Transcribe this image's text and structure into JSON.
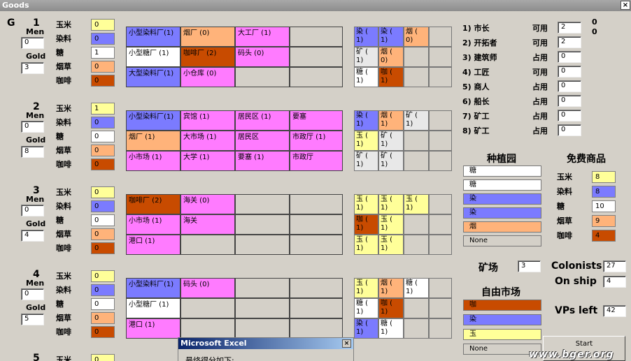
{
  "window": {
    "title": "Goods",
    "close": "×"
  },
  "g_label": "G",
  "labels": {
    "men": "Men",
    "gold": "Gold",
    "corn": "玉米",
    "indigo": "染料",
    "sugar": "糖",
    "tobacco": "烟草",
    "coffee": "咖啡"
  },
  "players": [
    {
      "num": "1",
      "men": "0",
      "gold": "3",
      "goods": [
        "0",
        "0",
        "1",
        "0",
        "0"
      ],
      "buildings": [
        [
          "小型染料厂(1)",
          "c-indigo"
        ],
        [
          "烟厂 (0)",
          "c-tobacco"
        ],
        [
          "大工厂 (1)",
          "c-pink"
        ],
        [
          "",
          ""
        ],
        [
          "小型糖厂 (1)",
          "c-sugar"
        ],
        [
          "咖啡厂 (2)",
          "c-coffee"
        ],
        [
          "码头 (0)",
          "c-pink"
        ],
        [
          "",
          ""
        ],
        [
          "大型染料厂(1)",
          "c-indigo"
        ],
        [
          "小仓库 (0)",
          "c-pink"
        ],
        [
          "",
          ""
        ],
        [
          "",
          ""
        ]
      ],
      "fields": [
        [
          "染 ( 1)",
          "c-indigo"
        ],
        [
          "染 ( 1)",
          "c-indigo"
        ],
        [
          "烟 ( 0)",
          "c-tobacco"
        ],
        [
          "",
          ""
        ],
        [
          "矿 ( 1)",
          "c-light"
        ],
        [
          "烟 ( 0)",
          "c-tobacco"
        ],
        [
          "",
          ""
        ],
        [
          "",
          ""
        ],
        [
          "糖 ( 1)",
          "c-sugar"
        ],
        [
          "咖 ( 1)",
          "c-coffee"
        ],
        [
          "",
          ""
        ],
        [
          "",
          ""
        ]
      ]
    },
    {
      "num": "2",
      "men": "0",
      "gold": "8",
      "goods": [
        "1",
        "0",
        "0",
        "0",
        "0"
      ],
      "buildings": [
        [
          "小型染料厂(1)",
          "c-indigo"
        ],
        [
          "宾馆 (1)",
          "c-pink"
        ],
        [
          "居民区 (1)",
          "c-pink"
        ],
        [
          "要塞",
          "c-pink"
        ],
        [
          "烟厂 (1)",
          "c-tobacco"
        ],
        [
          "大市场 (1)",
          "c-pink"
        ],
        [
          "居民区",
          "c-pink"
        ],
        [
          "市政厅 (1)",
          "c-pink"
        ],
        [
          "小市场 (1)",
          "c-pink"
        ],
        [
          "大学 (1)",
          "c-pink"
        ],
        [
          "要塞 (1)",
          "c-pink"
        ],
        [
          "市政厅",
          "c-pink"
        ]
      ],
      "fields": [
        [
          "染 ( 1)",
          "c-indigo"
        ],
        [
          "烟 ( 1)",
          "c-tobacco"
        ],
        [
          "矿 ( 1)",
          "c-light"
        ],
        [
          "",
          ""
        ],
        [
          "玉 ( 1)",
          "c-corn"
        ],
        [
          "矿 ( 1)",
          "c-light"
        ],
        [
          "",
          ""
        ],
        [
          "",
          ""
        ],
        [
          "矿 ( 1)",
          "c-light"
        ],
        [
          "矿 ( 1)",
          "c-light"
        ],
        [
          "",
          ""
        ],
        [
          "",
          ""
        ]
      ]
    },
    {
      "num": "3",
      "men": "0",
      "gold": "4",
      "goods": [
        "0",
        "0",
        "0",
        "0",
        "0"
      ],
      "buildings": [
        [
          "咖啡厂 (2)",
          "c-coffee"
        ],
        [
          "海关 (0)",
          "c-pink"
        ],
        [
          "",
          ""
        ],
        [
          "",
          ""
        ],
        [
          "小市场 (1)",
          "c-pink"
        ],
        [
          "海关",
          "c-pink"
        ],
        [
          "",
          ""
        ],
        [
          "",
          ""
        ],
        [
          "港口 (1)",
          "c-pink"
        ],
        [
          "",
          ""
        ],
        [
          "",
          ""
        ],
        [
          "",
          ""
        ]
      ],
      "fields": [
        [
          "玉 ( 1)",
          "c-corn"
        ],
        [
          "玉 ( 1)",
          "c-corn"
        ],
        [
          "玉 ( 1)",
          "c-corn"
        ],
        [
          "",
          ""
        ],
        [
          "咖 ( 1)",
          "c-coffee"
        ],
        [
          "玉 ( 1)",
          "c-corn"
        ],
        [
          "",
          ""
        ],
        [
          "",
          ""
        ],
        [
          "玉 ( 1)",
          "c-corn"
        ],
        [
          "玉 ( 1)",
          "c-corn"
        ],
        [
          "",
          ""
        ],
        [
          "",
          ""
        ]
      ]
    },
    {
      "num": "4",
      "men": "0",
      "gold": "5",
      "goods": [
        "0",
        "0",
        "0",
        "0",
        "0"
      ],
      "buildings": [
        [
          "小型染料厂(1)",
          "c-indigo"
        ],
        [
          "码头 (0)",
          "c-pink"
        ],
        [
          "",
          ""
        ],
        [
          "",
          ""
        ],
        [
          "小型糖厂 (1)",
          "c-sugar"
        ],
        [
          "",
          ""
        ],
        [
          "",
          ""
        ],
        [
          "",
          ""
        ],
        [
          "港口 (1)",
          "c-pink"
        ],
        [
          "",
          ""
        ],
        [
          "",
          ""
        ],
        [
          "",
          ""
        ]
      ],
      "fields": [
        [
          "玉 ( 1)",
          "c-corn"
        ],
        [
          "烟 ( 1)",
          "c-tobacco"
        ],
        [
          "糖 ( 1)",
          "c-sugar"
        ],
        [
          "",
          ""
        ],
        [
          "糖 ( 1)",
          "c-sugar"
        ],
        [
          "咖 ( 1)",
          "c-coffee"
        ],
        [
          "",
          ""
        ],
        [
          "",
          ""
        ],
        [
          "染 ( 1)",
          "c-indigo"
        ],
        [
          "糖 ( 1)",
          "c-sugar"
        ],
        [
          "",
          ""
        ],
        [
          "",
          ""
        ]
      ]
    }
  ],
  "p5": {
    "num": "5",
    "corn": "玉米",
    "value": "0"
  },
  "roles": [
    {
      "name": "1) 市长",
      "status": "可用",
      "value": "2"
    },
    {
      "name": "2) 开拓者",
      "status": "可用",
      "value": "2"
    },
    {
      "name": "3) 建筑师",
      "status": "占用",
      "value": "0"
    },
    {
      "name": "4) 工匠",
      "status": "可用",
      "value": "0"
    },
    {
      "name": "5) 商人",
      "status": "占用",
      "value": "0"
    },
    {
      "name": "6) 船长",
      "status": "占用",
      "value": "0"
    },
    {
      "name": "7) 矿工",
      "status": "占用",
      "value": "0"
    },
    {
      "name": "8) 矿工",
      "status": "占用",
      "value": "0"
    }
  ],
  "top_right": [
    "0",
    "0"
  ],
  "plantation": {
    "title": "种植园",
    "items": [
      [
        "糖",
        "c-sugar"
      ],
      [
        "糖",
        "c-sugar"
      ],
      [
        "染",
        "c-indigo"
      ],
      [
        "染",
        "c-indigo"
      ],
      [
        "烟",
        "c-tobacco"
      ],
      [
        "None",
        "c-gray"
      ]
    ]
  },
  "free_goods": {
    "title": "免费商品",
    "items": [
      [
        "玉米",
        "8",
        "c-corn"
      ],
      [
        "染料",
        "8",
        "c-indigo"
      ],
      [
        "糖",
        "10",
        "c-sugar"
      ],
      [
        "烟草",
        "9",
        "c-tobacco"
      ],
      [
        "咖啡",
        "4",
        "c-coffee"
      ]
    ]
  },
  "quarry": {
    "label": "矿场",
    "value": "3"
  },
  "colonists": {
    "label": "Colonists",
    "value": "27"
  },
  "on_ship": {
    "label": "On ship",
    "value": "4"
  },
  "market": {
    "title": "自由市场",
    "items": [
      [
        "咖",
        "c-coffee"
      ],
      [
        "染",
        "c-indigo"
      ],
      [
        "玉",
        "c-corn"
      ],
      [
        "None",
        "c-gray"
      ]
    ]
  },
  "vps": {
    "label": "VPs left",
    "value": "42"
  },
  "start": "Start",
  "dialog": {
    "title": "Microsoft Excel",
    "close": "×",
    "text": "最终得分如下:"
  },
  "watermark": "www.bger.org"
}
